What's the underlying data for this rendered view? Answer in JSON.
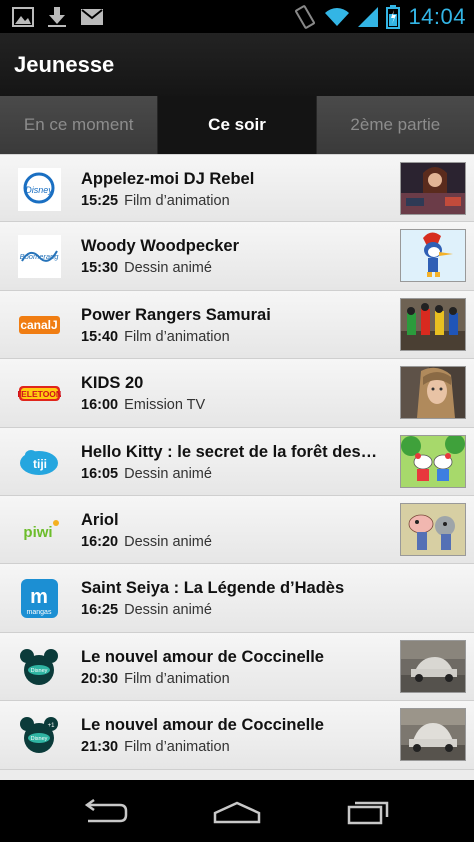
{
  "status_bar": {
    "time": "14:04",
    "icons": [
      "gallery-icon",
      "download-icon",
      "gmail-icon",
      "vibrate-icon",
      "wifi-icon",
      "signal-icon",
      "battery-icon"
    ],
    "accent_color": "#33b5e5"
  },
  "header": {
    "title": "Jeunesse"
  },
  "tabs": [
    {
      "label": "En ce moment",
      "active": false
    },
    {
      "label": "Ce soir",
      "active": true
    },
    {
      "label": "2ème partie",
      "active": false
    }
  ],
  "programs": [
    {
      "channel_icon": "disney-channel-logo",
      "title": "Appelez-moi DJ Rebel",
      "time": "15:25",
      "genre": "Film d’animation",
      "has_thumbnail": true
    },
    {
      "channel_icon": "boomerang-logo",
      "title": "Woody Woodpecker",
      "time": "15:30",
      "genre": "Dessin animé",
      "has_thumbnail": true
    },
    {
      "channel_icon": "canal-j-logo",
      "title": "Power Rangers Samurai",
      "time": "15:40",
      "genre": "Film d’animation",
      "has_thumbnail": true
    },
    {
      "channel_icon": "teletoon-logo",
      "title": "KIDS 20",
      "time": "16:00",
      "genre": "Emission TV",
      "has_thumbnail": true
    },
    {
      "channel_icon": "tiji-logo",
      "title": "Hello Kitty : le secret de la forêt des p…",
      "time": "16:05",
      "genre": "Dessin animé",
      "has_thumbnail": true
    },
    {
      "channel_icon": "piwi-logo",
      "title": "Ariol",
      "time": "16:20",
      "genre": "Dessin animé",
      "has_thumbnail": true
    },
    {
      "channel_icon": "mangas-logo",
      "title": "Saint Seiya : La Légende d’Hadès",
      "time": "16:25",
      "genre": "Dessin animé",
      "has_thumbnail": false
    },
    {
      "channel_icon": "disney-cinemagic-logo",
      "title": "Le nouvel amour de Coccinelle",
      "time": "20:30",
      "genre": "Film d’animation",
      "has_thumbnail": true
    },
    {
      "channel_icon": "disney-cinemagic-plus1-logo",
      "title": "Le nouvel amour de Coccinelle",
      "time": "21:30",
      "genre": "Film d’animation",
      "has_thumbnail": true
    }
  ],
  "nav_bar": {
    "icons": [
      "back-icon",
      "home-icon",
      "recent-apps-icon"
    ]
  }
}
